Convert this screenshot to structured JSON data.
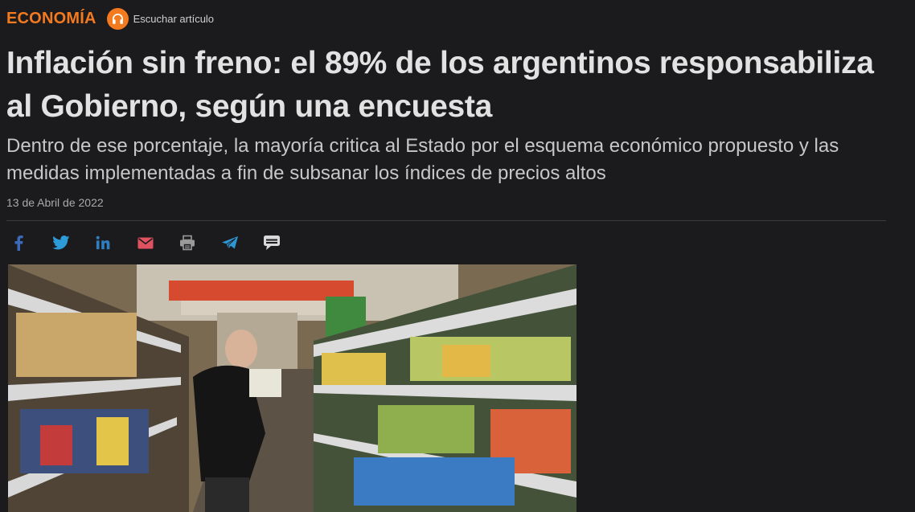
{
  "article": {
    "section": "ECONOMÍA",
    "listen_label": "Escuchar artículo",
    "title": "Inflación sin freno: el 89% de los argentinos responsabiliza al Gobierno, según una encuesta",
    "subtitle": "Dentro de ese porcentaje, la mayoría critica al Estado por el esquema económico propuesto y las medidas implementadas a fin de subsanar los índices de precios altos",
    "date": "13 de Abril de 2022"
  },
  "share": [
    {
      "name": "facebook-icon",
      "color": "#3b6bb8"
    },
    {
      "name": "twitter-icon",
      "color": "#2d9bd8"
    },
    {
      "name": "linkedin-icon",
      "color": "#2f7fc0"
    },
    {
      "name": "email-icon",
      "color": "#e0525f"
    },
    {
      "name": "print-icon",
      "color": "#9a9a9a"
    },
    {
      "name": "telegram-icon",
      "color": "#2e96d4"
    },
    {
      "name": "sms-icon",
      "color": "#d8d8d8"
    }
  ],
  "colors": {
    "accent": "#f47a20",
    "background": "#1b1b1d",
    "headline": "#e2e2e2"
  }
}
